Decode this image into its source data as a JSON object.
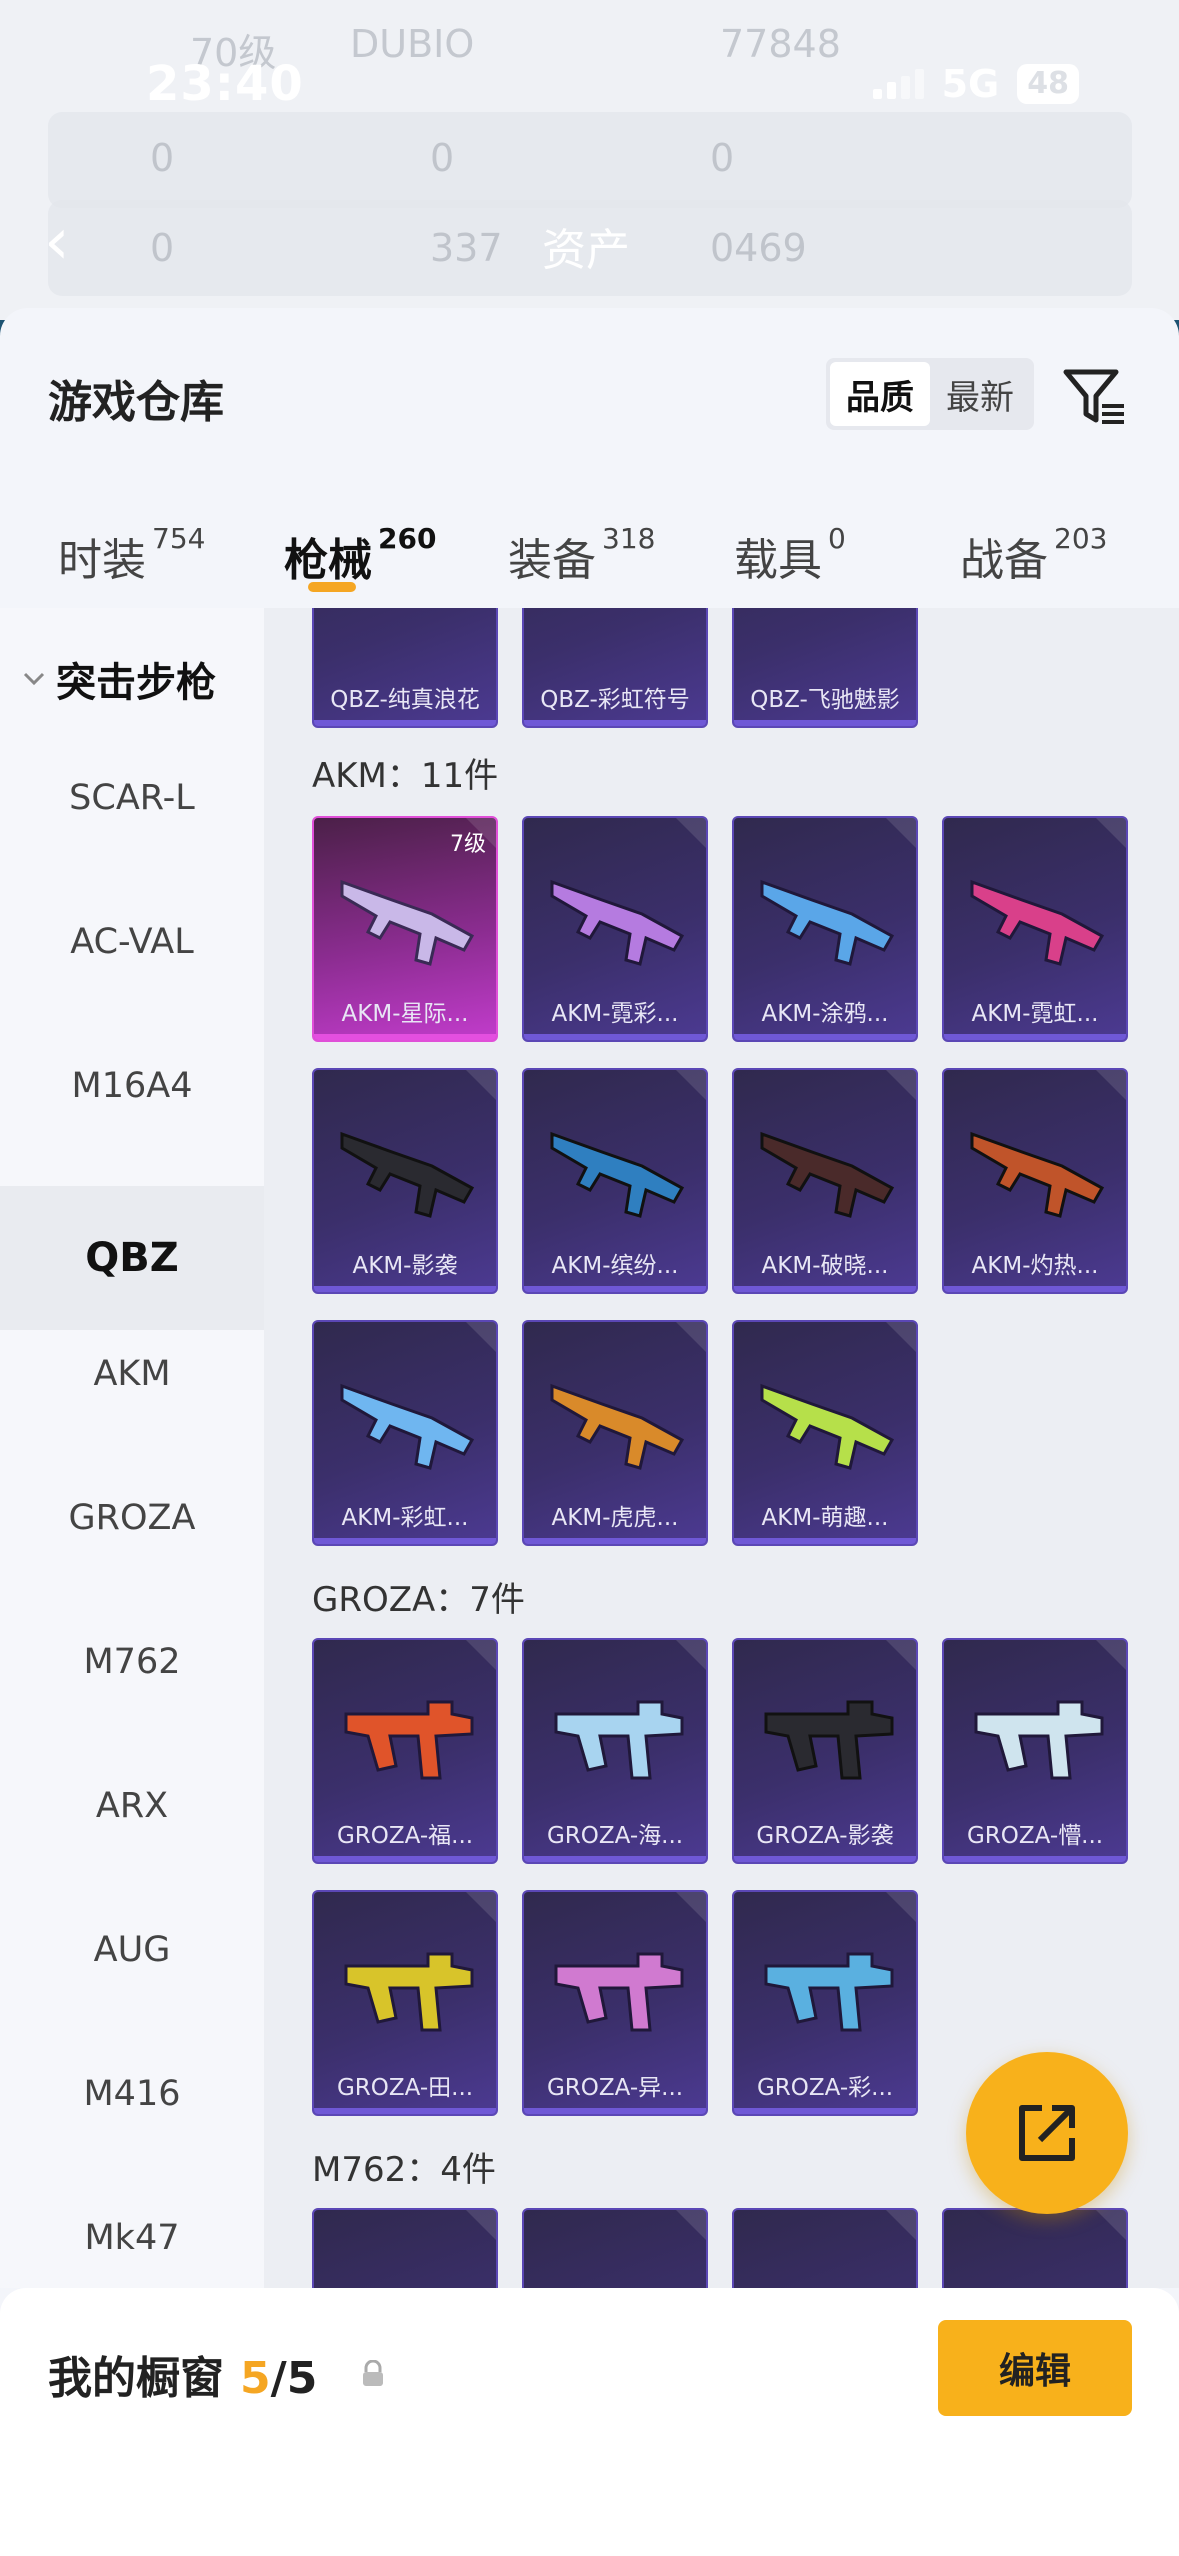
{
  "status_bar": {
    "time": "23:40",
    "network": "5G",
    "battery": "48"
  },
  "background": {
    "title": "资产",
    "level": "70级",
    "name": "DUBIO",
    "score": "77848",
    "zero": "0",
    "num1": "337",
    "num2": "0469"
  },
  "sheet": {
    "title": "游戏仓库",
    "sort": [
      "品质",
      "最新"
    ]
  },
  "tabs": [
    {
      "label": "时装",
      "count": "754"
    },
    {
      "label": "枪械",
      "count": "260"
    },
    {
      "label": "装备",
      "count": "318"
    },
    {
      "label": "载具",
      "count": "0"
    },
    {
      "label": "战备",
      "count": "203"
    }
  ],
  "category": {
    "title": "突击步枪"
  },
  "nav": [
    "SCAR-L",
    "AC-VAL",
    "M16A4",
    "QBZ",
    "AKM",
    "GROZA",
    "M762",
    "ARX",
    "AUG",
    "M416",
    "Mk47"
  ],
  "sections": {
    "akm": "AKM：11件",
    "groza": "GROZA：7件",
    "m762": "M762：4件"
  },
  "qbz_items": [
    "QBZ-纯真浪花",
    "QBZ-彩虹符号",
    "QBZ-飞驰魅影"
  ],
  "akm_items": [
    "AKM-星际...",
    "AKM-霓彩...",
    "AKM-涂鸦...",
    "AKM-霓虹...",
    "AKM-影袭",
    "AKM-缤纷...",
    "AKM-破晓...",
    "AKM-灼热...",
    "AKM-彩虹...",
    "AKM-虎虎...",
    "AKM-萌趣..."
  ],
  "akm_level": "7级",
  "groza_items": [
    "GROZA-福...",
    "GROZA-海...",
    "GROZA-影袭",
    "GROZA-懵...",
    "GROZA-田...",
    "GROZA-异...",
    "GROZA-彩..."
  ],
  "bottom": {
    "label": "我的橱窗",
    "count": "5",
    "total": "/5",
    "edit": "编辑"
  },
  "colors": {
    "accent": "#f8b11b",
    "card_purple": "#3b2f6b",
    "card_pink": "#c23ccc"
  }
}
